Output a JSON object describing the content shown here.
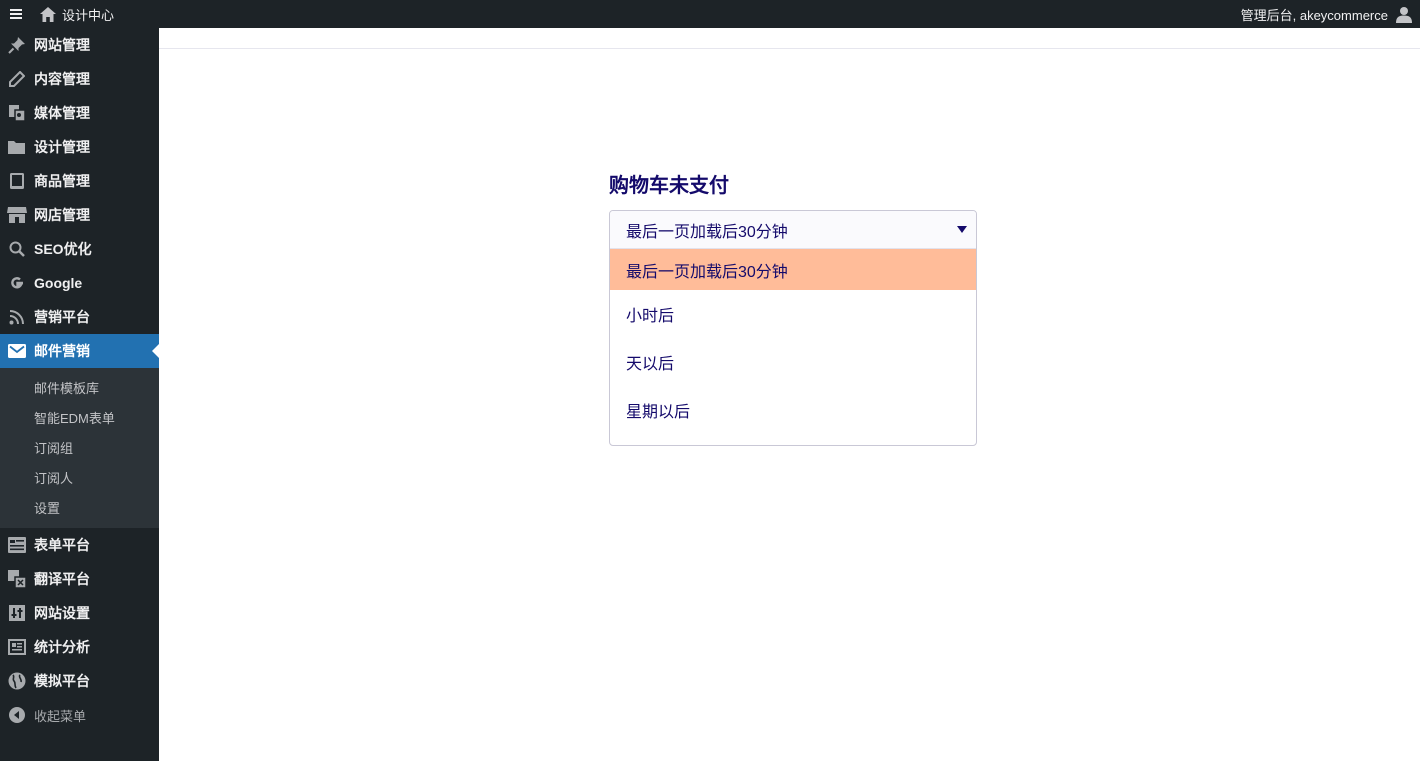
{
  "topbar": {
    "home_label": "设计中心",
    "account_label": "管理后台, akeycommerce"
  },
  "sidebar": {
    "items": [
      {
        "label": "网站管理",
        "icon": "pin-icon"
      },
      {
        "label": "内容管理",
        "icon": "pencil-icon"
      },
      {
        "label": "媒体管理",
        "icon": "media-icon"
      },
      {
        "label": "设计管理",
        "icon": "folder-icon"
      },
      {
        "label": "商品管理",
        "icon": "book-icon"
      },
      {
        "label": "网店管理",
        "icon": "store-icon"
      },
      {
        "label": "SEO优化",
        "icon": "search-icon"
      },
      {
        "label": "Google",
        "icon": "google-icon"
      },
      {
        "label": "营销平台",
        "icon": "rss-icon"
      },
      {
        "label": "邮件营销",
        "icon": "mail-icon"
      }
    ],
    "submenu": [
      "邮件模板库",
      "智能EDM表单",
      "订阅组",
      "订阅人",
      "设置"
    ],
    "items_after": [
      {
        "label": "表单平台",
        "icon": "form-icon"
      },
      {
        "label": "翻译平台",
        "icon": "translate-icon"
      },
      {
        "label": "网站设置",
        "icon": "settings-icon"
      },
      {
        "label": "统计分析",
        "icon": "analytics-icon"
      },
      {
        "label": "模拟平台",
        "icon": "globe-icon"
      }
    ],
    "collapse_label": "收起菜单"
  },
  "main": {
    "heading": "购物车未支付",
    "dropdown": {
      "selected": "最后一页加载后30分钟",
      "options": [
        "最后一页加载后30分钟",
        "小时后",
        "天以后",
        "星期以后"
      ]
    }
  },
  "colors": {
    "sidebar_bg": "#1d2327",
    "active_bg": "#2271b1",
    "highlight_option": "#ffbc99",
    "text_primary": "#140a6b"
  }
}
